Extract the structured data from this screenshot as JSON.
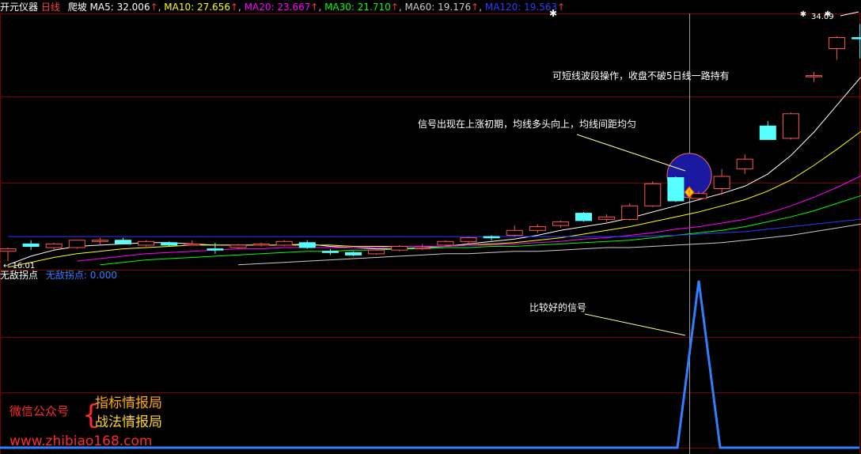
{
  "header": {
    "app_title": "开元仪器",
    "period": "日线",
    "indicator": "爬坡",
    "ma": [
      {
        "label": "MA5: ",
        "value": "32.006",
        "arrow": "↑",
        "sep": ", ",
        "color": "#ffffff"
      },
      {
        "label": "MA10: ",
        "value": "27.656",
        "arrow": "↑",
        "sep": ", ",
        "color": "#ffff00"
      },
      {
        "label": "MA20: ",
        "value": "23.667",
        "arrow": "↑",
        "sep": ", ",
        "color": "#ff00ff"
      },
      {
        "label": "MA30: ",
        "value": "21.710",
        "arrow": "↑",
        "sep": ", ",
        "color": "#00ff00"
      },
      {
        "label": "MA60: ",
        "value": "19.176",
        "arrow": "↑",
        "sep": ", ",
        "color": "#cccccc"
      },
      {
        "label": "MA120: ",
        "value": "19.563",
        "arrow": "↑",
        "sep": "",
        "color": "#2b3bff"
      }
    ]
  },
  "price_labels": {
    "low": "16.01",
    "high": "34.09"
  },
  "annotations": {
    "hold": "可短线波段操作，收盘不破5日线一路持有",
    "signal": "信号出现在上涨初期，均线多头向上，均线间距均匀",
    "sub_signal": "比较好的信号"
  },
  "sub_panel": {
    "name": "无敌拐点",
    "value_label": "无敌拐点: ",
    "value": "0.000"
  },
  "watermark": {
    "account_label": "微信公众号",
    "line1": "指标情报局",
    "line2": "战法情报局",
    "url": "www.zhibiao168.com"
  },
  "colors": {
    "background": "#000000",
    "grid": "#7a0000",
    "up_candle": "#ff5555",
    "down_candle": "#55ffff",
    "signal_circle": "#1a1aa0",
    "indicator_line": "#2f7fff"
  },
  "chart_data": {
    "type": "candlestick",
    "ylim": [
      15.2,
      36.0
    ],
    "candles": [
      {
        "o": 16.7,
        "h": 17.0,
        "l": 15.9,
        "c": 16.9
      },
      {
        "o": 17.3,
        "h": 17.6,
        "l": 16.8,
        "c": 17.1
      },
      {
        "o": 17.0,
        "h": 17.4,
        "l": 16.8,
        "c": 17.3
      },
      {
        "o": 17.0,
        "h": 17.6,
        "l": 16.9,
        "c": 17.6
      },
      {
        "o": 17.5,
        "h": 17.8,
        "l": 17.2,
        "c": 17.6
      },
      {
        "o": 17.6,
        "h": 17.8,
        "l": 17.3,
        "c": 17.3
      },
      {
        "o": 17.2,
        "h": 17.6,
        "l": 17.1,
        "c": 17.5
      },
      {
        "o": 17.4,
        "h": 17.5,
        "l": 17.1,
        "c": 17.2
      },
      {
        "o": 17.3,
        "h": 17.6,
        "l": 17.2,
        "c": 17.3
      },
      {
        "o": 16.9,
        "h": 17.4,
        "l": 16.5,
        "c": 16.8
      },
      {
        "o": 17.0,
        "h": 17.3,
        "l": 16.9,
        "c": 17.2
      },
      {
        "o": 17.2,
        "h": 17.4,
        "l": 17.1,
        "c": 17.3
      },
      {
        "o": 17.2,
        "h": 17.6,
        "l": 17.1,
        "c": 17.5
      },
      {
        "o": 17.4,
        "h": 17.6,
        "l": 16.9,
        "c": 17.0
      },
      {
        "o": 16.7,
        "h": 16.9,
        "l": 16.4,
        "c": 16.6
      },
      {
        "o": 16.6,
        "h": 16.7,
        "l": 16.3,
        "c": 16.4
      },
      {
        "o": 16.5,
        "h": 16.9,
        "l": 16.4,
        "c": 16.8
      },
      {
        "o": 16.8,
        "h": 17.2,
        "l": 16.7,
        "c": 17.1
      },
      {
        "o": 17.0,
        "h": 17.3,
        "l": 16.8,
        "c": 17.0
      },
      {
        "o": 17.2,
        "h": 17.6,
        "l": 17.1,
        "c": 17.5
      },
      {
        "o": 17.5,
        "h": 17.9,
        "l": 17.3,
        "c": 17.8
      },
      {
        "o": 17.9,
        "h": 18.0,
        "l": 17.6,
        "c": 17.8
      },
      {
        "o": 18.0,
        "h": 18.8,
        "l": 17.9,
        "c": 18.4
      },
      {
        "o": 18.4,
        "h": 18.9,
        "l": 18.2,
        "c": 18.7
      },
      {
        "o": 18.8,
        "h": 19.2,
        "l": 18.6,
        "c": 19.1
      },
      {
        "o": 19.8,
        "h": 19.9,
        "l": 19.1,
        "c": 19.2
      },
      {
        "o": 19.3,
        "h": 19.7,
        "l": 19.1,
        "c": 19.5
      },
      {
        "o": 19.3,
        "h": 20.6,
        "l": 19.2,
        "c": 20.4
      },
      {
        "o": 20.4,
        "h": 22.4,
        "l": 20.3,
        "c": 22.2
      },
      {
        "o": 22.7,
        "h": 22.8,
        "l": 20.7,
        "c": 20.8
      },
      {
        "o": 21.0,
        "h": 21.6,
        "l": 20.9,
        "c": 21.4
      },
      {
        "o": 21.8,
        "h": 23.4,
        "l": 21.3,
        "c": 22.8
      },
      {
        "o": 23.4,
        "h": 24.6,
        "l": 23.0,
        "c": 24.2
      },
      {
        "o": 26.9,
        "h": 27.3,
        "l": 25.9,
        "c": 25.8
      },
      {
        "o": 25.9,
        "h": 28.0,
        "l": 25.8,
        "c": 27.9
      },
      {
        "o": 31.0,
        "h": 31.3,
        "l": 30.5,
        "c": 31.0
      },
      {
        "o": 33.2,
        "h": 34.2,
        "l": 32.3,
        "c": 34.1
      },
      {
        "o": 34.1,
        "h": 35.2,
        "l": 32.4,
        "c": 34.0
      },
      {
        "o": 33.3,
        "h": 35.1,
        "l": 32.3,
        "c": 33.8
      }
    ],
    "ma_lines": [
      {
        "key": "MA5",
        "color": "#ffffff",
        "values": [
          15.6,
          16.3,
          16.8,
          17.1,
          17.2,
          17.3,
          17.4,
          17.4,
          17.3,
          17.2,
          17.2,
          17.2,
          17.2,
          17.3,
          17.1,
          17.0,
          16.9,
          16.9,
          17.0,
          17.1,
          17.3,
          17.5,
          17.7,
          18.0,
          18.4,
          18.7,
          19.0,
          19.4,
          19.9,
          20.4,
          20.9,
          21.4,
          22.0,
          23.0,
          24.5,
          26.4,
          28.6,
          30.8,
          32.0
        ]
      },
      {
        "key": "MA10",
        "color": "#ffff00",
        "values": [
          15.4,
          15.8,
          16.2,
          16.5,
          16.7,
          16.9,
          17.0,
          17.1,
          17.2,
          17.2,
          17.2,
          17.2,
          17.2,
          17.2,
          17.2,
          17.1,
          17.1,
          17.1,
          17.1,
          17.1,
          17.2,
          17.3,
          17.4,
          17.6,
          17.8,
          18.1,
          18.4,
          18.7,
          19.1,
          19.5,
          19.9,
          20.4,
          20.9,
          21.6,
          22.5,
          23.7,
          25.0,
          26.4,
          27.7
        ]
      },
      {
        "key": "MA20",
        "color": "#ff00ff",
        "values": [
          null,
          null,
          null,
          15.9,
          16.1,
          16.3,
          16.5,
          16.6,
          16.7,
          16.8,
          16.9,
          16.9,
          17.0,
          17.0,
          17.0,
          17.0,
          17.0,
          17.1,
          17.1,
          17.1,
          17.2,
          17.2,
          17.3,
          17.4,
          17.5,
          17.7,
          17.8,
          18.0,
          18.2,
          18.5,
          18.7,
          19.0,
          19.3,
          19.8,
          20.4,
          21.1,
          21.9,
          22.8,
          23.7
        ]
      },
      {
        "key": "MA30",
        "color": "#00ff00",
        "values": [
          null,
          null,
          null,
          null,
          15.6,
          15.8,
          16.0,
          16.1,
          16.2,
          16.3,
          16.4,
          16.5,
          16.6,
          16.7,
          16.7,
          16.8,
          16.8,
          16.9,
          16.9,
          17.0,
          17.0,
          17.1,
          17.1,
          17.2,
          17.3,
          17.4,
          17.5,
          17.6,
          17.8,
          18.0,
          18.2,
          18.4,
          18.7,
          19.1,
          19.5,
          20.0,
          20.6,
          21.2,
          21.7
        ]
      },
      {
        "key": "MA60",
        "color": "#cccccc",
        "values": [
          null,
          null,
          null,
          null,
          null,
          null,
          null,
          null,
          null,
          null,
          15.6,
          15.7,
          15.8,
          15.9,
          16.0,
          16.1,
          16.2,
          16.3,
          16.4,
          16.5,
          16.5,
          16.6,
          16.7,
          16.7,
          16.8,
          16.9,
          17.0,
          17.0,
          17.1,
          17.2,
          17.3,
          17.4,
          17.6,
          17.8,
          18.0,
          18.3,
          18.6,
          18.9,
          19.2
        ]
      },
      {
        "key": "MA120",
        "color": "#2b3bff",
        "values": [
          17.9,
          17.9,
          17.9,
          17.9,
          17.9,
          17.9,
          17.9,
          17.9,
          17.9,
          17.9,
          17.9,
          17.9,
          17.9,
          17.9,
          17.9,
          17.9,
          17.9,
          17.9,
          17.9,
          17.9,
          17.9,
          17.9,
          17.9,
          17.9,
          17.9,
          17.9,
          17.9,
          17.9,
          17.95,
          18.0,
          18.1,
          18.2,
          18.3,
          18.5,
          18.7,
          18.9,
          19.1,
          19.3,
          19.5
        ]
      }
    ],
    "signal_index": 30,
    "indicator": {
      "name": "无敌拐点",
      "ylim": [
        0,
        1.0
      ],
      "values": [
        0,
        0,
        0,
        0,
        0,
        0,
        0,
        0,
        0,
        0,
        0,
        0,
        0,
        0,
        0,
        0,
        0,
        0,
        0,
        0,
        0,
        0,
        0,
        0,
        0,
        0,
        0,
        0,
        0,
        0,
        1,
        0,
        0,
        0,
        0,
        0,
        0,
        0,
        0
      ]
    }
  }
}
